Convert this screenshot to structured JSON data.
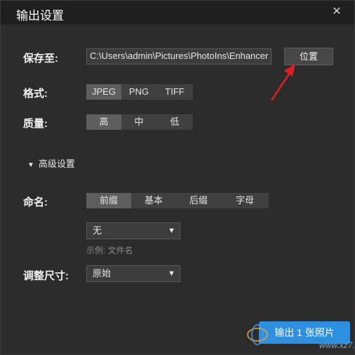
{
  "dialog": {
    "title": "输出设置",
    "close_glyph": "✕"
  },
  "save": {
    "label": "保存至:",
    "path": "C:\\Users\\admin\\Pictures\\PhotoIns\\Enhancer",
    "button": "位置"
  },
  "format": {
    "label": "格式:",
    "options": [
      "JPEG",
      "PNG",
      "TIFF"
    ],
    "selected": "JPEG"
  },
  "quality": {
    "label": "质量:",
    "options": [
      "高",
      "中",
      "低"
    ],
    "selected": "高"
  },
  "advanced": {
    "label": "高级设置",
    "chevron": "▼"
  },
  "naming": {
    "label": "命名:",
    "options": [
      "前缀",
      "基本",
      "后缀",
      "字母"
    ],
    "selected": "前缀",
    "select_value": "无",
    "example": "示例: 文件名"
  },
  "resize": {
    "label": "调整尺寸:",
    "select_value": "原始"
  },
  "export": {
    "label": "输出 1 张照片"
  },
  "watermark": {
    "text": "www.xz7.com"
  },
  "colors": {
    "accent": "#2d8fe0",
    "arrow": "#e02020"
  }
}
